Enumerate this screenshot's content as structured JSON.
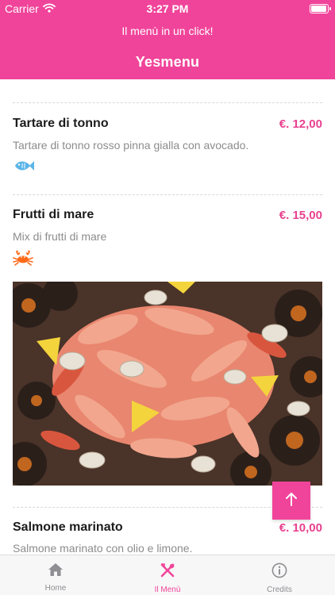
{
  "status_bar": {
    "carrier": "Carrier",
    "time": "3:27 PM",
    "battery_level": 1.0
  },
  "header": {
    "subtitle": "Il menù in un click!",
    "title": "Yesmenu"
  },
  "colors": {
    "accent": "#f0449a",
    "price": "#e8418f",
    "fish_icon": "#5bb5e8",
    "crab_icon": "#ff6a1a"
  },
  "items": [
    {
      "name": "Tartare di tonno",
      "price": "€. 12,00",
      "description": "Tartare di tonno rosso pinna gialla con avocado.",
      "allergen_icon": "fish-icon"
    },
    {
      "name": "Frutti di mare",
      "price": "€. 15,00",
      "description": "Mix di frutti di mare",
      "allergen_icon": "crab-icon",
      "image": "seafood-platter"
    },
    {
      "name": "Salmone marinato",
      "price": "€. 10,00",
      "description": "Salmone marinato con olio e limone."
    }
  ],
  "scroll_top_icon": "arrow-up-icon",
  "tabbar": {
    "tabs": [
      {
        "label": "Home",
        "icon": "home-icon",
        "active": false
      },
      {
        "label": "Il Menù",
        "icon": "fork-knife-icon",
        "active": true
      },
      {
        "label": "Credits",
        "icon": "info-icon",
        "active": false
      }
    ]
  }
}
